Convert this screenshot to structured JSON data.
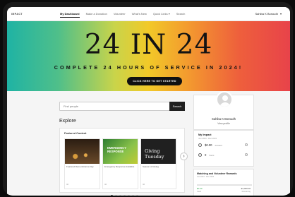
{
  "nav": {
    "logo": "IMPACT",
    "links": [
      "My Dashboard",
      "Make a Donation",
      "Volunteer",
      "What's New",
      "Quick Links ▾",
      "Search"
    ],
    "user": "Sahiba K Boroudh",
    "user_caret": "▾"
  },
  "hero": {
    "title": "24 IN 24",
    "subtitle": "COMPLETE 24 HOURS OF SERVICE IN 2024!",
    "cta": "CLICK HERE TO GET STARTED"
  },
  "search": {
    "placeholder": "Find people",
    "button": "Search"
  },
  "explore": {
    "heading": "Explore",
    "featured_title": "Featured Content",
    "tiles": [
      {
        "overlay": "",
        "caption": "Featured Remembrance Day",
        "meta": "3d"
      },
      {
        "overlay": "EMERGENCY RESPONSE",
        "caption": "Emergency Response Available",
        "meta": "3d"
      },
      {
        "overlay": "Giving Tuesday",
        "caption": "Season of Giving",
        "meta": "3d"
      }
    ],
    "next_label": "›",
    "dots": 7
  },
  "profile": {
    "name": "Sahiba K Boroudh",
    "link": "View profile"
  },
  "impact": {
    "title": "My Impact",
    "subtitle": "Jan 2024 - Dec 2024",
    "donated": "$0.00",
    "donated_label": "donated",
    "hours": "0",
    "hours_label": "hours"
  },
  "matching": {
    "title": "Matching and Volunteer Rewards",
    "subtitle": "Jan 2024 - Dec 2024",
    "used": "$0.00",
    "total": "$1,000.00",
    "used_label": "Used",
    "remaining_label": "Remaining",
    "progress_fraction": 0.0
  }
}
